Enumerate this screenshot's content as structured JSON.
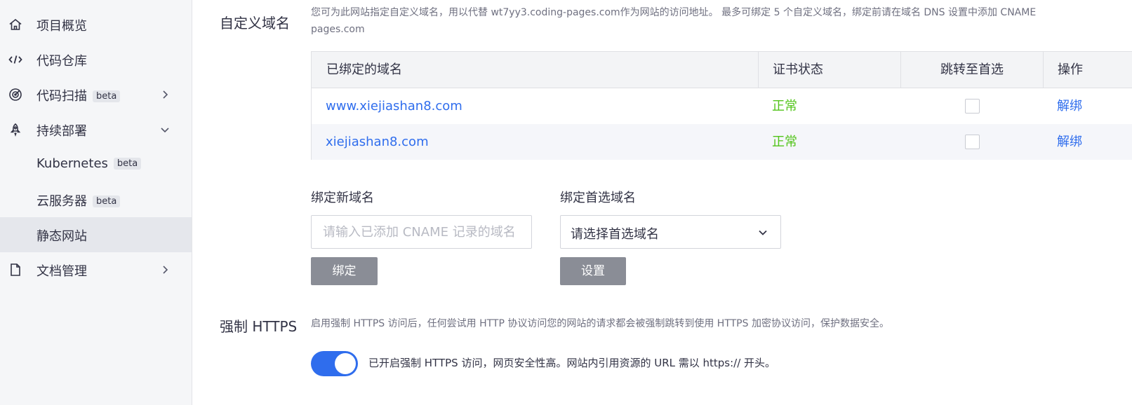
{
  "sidebar": {
    "items": [
      {
        "label": "项目概览",
        "icon": "home-icon"
      },
      {
        "label": "代码仓库",
        "icon": "code-icon"
      },
      {
        "label": "代码扫描",
        "badge": "beta",
        "icon": "radar-icon",
        "chevron": "right"
      },
      {
        "label": "持续部署",
        "icon": "rocket-icon",
        "chevron": "down"
      },
      {
        "label": "Kubernetes",
        "badge": "beta"
      },
      {
        "label": "云服务器",
        "badge": "beta"
      },
      {
        "label": "静态网站",
        "active": true
      },
      {
        "label": "文档管理",
        "icon": "document-icon",
        "chevron": "right"
      }
    ]
  },
  "custom_domain": {
    "title": "自定义域名",
    "desc_line1": "您可为此网站指定自定义域名，用以代替 wt7yy3.coding-pages.com作为网站的访问地址。 最多可绑定 5 个自定义域名，绑定前请在域名 DNS 设置中添加 CNAME",
    "desc_line2": "pages.com",
    "table": {
      "headers": [
        "已绑定的域名",
        "证书状态",
        "跳转至首选",
        "操作"
      ],
      "rows": [
        {
          "domain": "www.xiejiashan8.com",
          "status": "正常",
          "action": "解绑"
        },
        {
          "domain": "xiejiashan8.com",
          "status": "正常",
          "action": "解绑"
        }
      ]
    },
    "bind_new": {
      "label": "绑定新域名",
      "placeholder": "请输入已添加 CNAME 记录的域名",
      "button": "绑定"
    },
    "bind_preferred": {
      "label": "绑定首选域名",
      "selected": "请选择首选域名",
      "button": "设置"
    }
  },
  "https": {
    "title": "强制 HTTPS",
    "desc": "启用强制 HTTPS 访问后，任何尝试用 HTTP 协议访问您的网站的请求都会被强制跳转到使用 HTTPS 加密协议访问，保护数据安全。",
    "toggle_on": true,
    "toggle_text": "已开启强制 HTTPS 访问，网页安全性高。网站内引用资源的 URL 需以 https:// 开头。"
  },
  "colors": {
    "accent": "#2f6ded",
    "success": "#52c41a",
    "button_gray": "#8a8d96"
  }
}
